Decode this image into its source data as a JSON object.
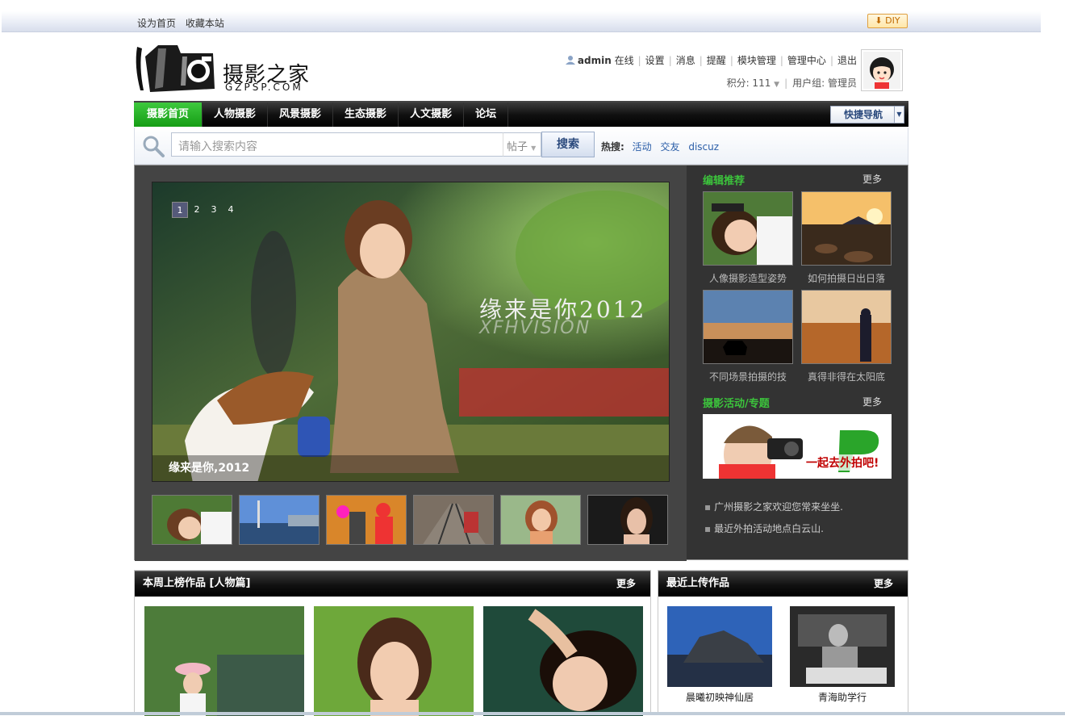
{
  "topbar": {
    "set_home": "设为首页",
    "bookmark": "收藏本站",
    "diy": "DIY"
  },
  "logo": {
    "title": "摄影之家",
    "subtitle": "GZPSP.COM"
  },
  "user": {
    "name": "admin",
    "status": "在线",
    "links": [
      "设置",
      "消息",
      "提醒",
      "模块管理",
      "管理中心",
      "退出"
    ],
    "points_label": "积分: 111",
    "group_label": "用户组: 管理员"
  },
  "nav": {
    "items": [
      "摄影首页",
      "人物摄影",
      "风景摄影",
      "生态摄影",
      "人文摄影",
      "论坛"
    ],
    "quick": "快捷导航"
  },
  "search": {
    "placeholder": "请输入搜索内容",
    "type": "帖子",
    "button": "搜索",
    "hot_label": "热搜:",
    "hot_links": [
      "活动",
      "交友",
      "discuz"
    ]
  },
  "slider": {
    "pages": [
      "1",
      "2",
      "3",
      "4"
    ],
    "caption": "缘来是你,2012",
    "overlay_text": "缘来是你2012",
    "overlay_sub": "XFHVISION"
  },
  "recommend": {
    "title": "编辑推荐",
    "more": "更多",
    "items": [
      "人像摄影造型姿势",
      "如何拍摄日出日落",
      "不同场景拍摄的技",
      "真得非得在太阳底"
    ]
  },
  "events": {
    "title": "摄影活动/专题",
    "more": "更多",
    "banner_text": "一起去外拍吧!",
    "notes": [
      "广州摄影之家欢迎您常来坐坐.",
      "最近外拍活动地点白云山."
    ]
  },
  "weekly": {
    "title": "本周上榜作品 [人物篇]",
    "more": "更多"
  },
  "recent": {
    "title": "最近上传作品",
    "more": "更多",
    "items": [
      "晨曦初映神仙居",
      "青海助学行"
    ]
  }
}
